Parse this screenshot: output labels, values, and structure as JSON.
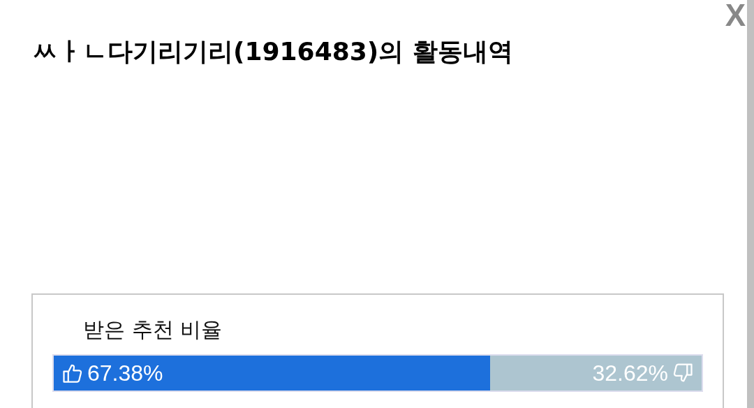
{
  "title": "ㅆㅏㄴ다기리기리(1916483)의 활동내역",
  "close_button": "X",
  "recommend_ratio": {
    "label": "받은 추천 비율",
    "level": 0.6738,
    "up_reading": "67.38%",
    "down_reading": "32.62%"
  }
}
